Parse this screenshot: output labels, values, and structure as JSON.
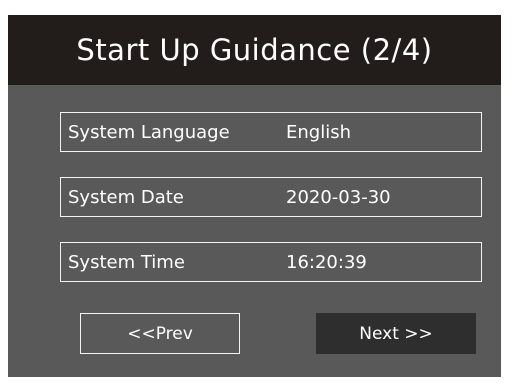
{
  "header": {
    "title": "Start Up Guidance (2/4)"
  },
  "fields": [
    {
      "label": "System Language",
      "value": "English"
    },
    {
      "label": "System Date",
      "value": "2020-03-30"
    },
    {
      "label": "System Time",
      "value": "16:20:39"
    }
  ],
  "buttons": {
    "prev_label": "<<Prev",
    "next_label": "Next >>"
  },
  "colors": {
    "header_bg": "#221d1a",
    "panel_bg": "#595959",
    "next_button_bg": "#2e2e2e",
    "text": "#ffffff",
    "border": "#f2f2f2"
  }
}
